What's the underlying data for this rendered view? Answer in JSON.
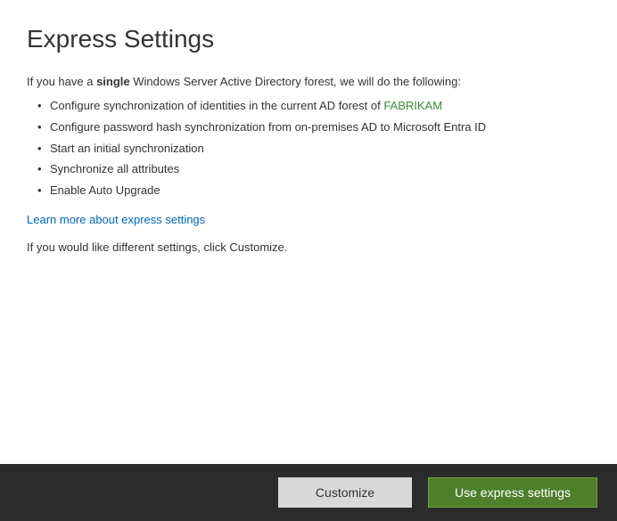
{
  "heading": "Express Settings",
  "intro_prefix": "If you have a ",
  "intro_bold": "single",
  "intro_suffix": " Windows Server Active Directory forest, we will do the following:",
  "bullets": {
    "item0_prefix": "Configure synchronization of identities in the current AD forest of ",
    "item0_forest": "FABRIKAM",
    "item1": "Configure password hash synchronization from on-premises AD to Microsoft Entra ID",
    "item2": "Start an initial synchronization",
    "item3": "Synchronize all attributes",
    "item4": "Enable Auto Upgrade"
  },
  "learn_more": "Learn more about express settings",
  "customize_note": "If you would like different settings, click Customize.",
  "footer": {
    "customize": "Customize",
    "express": "Use express settings"
  }
}
